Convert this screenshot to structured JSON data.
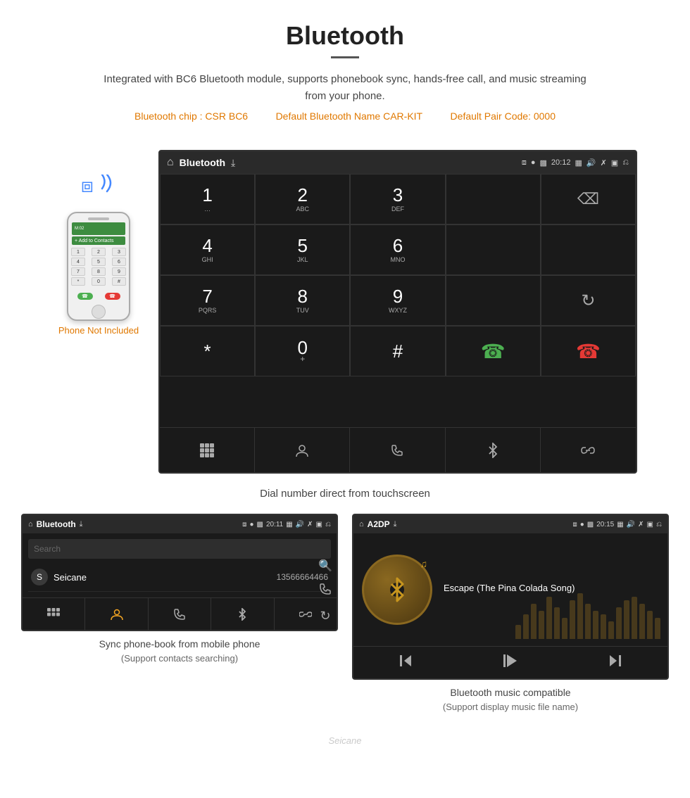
{
  "header": {
    "title": "Bluetooth",
    "description": "Integrated with BC6 Bluetooth module, supports phonebook sync, hands-free call, and music streaming from your phone.",
    "bluetooth_chip": "Bluetooth chip : CSR BC6",
    "default_name": "Default Bluetooth Name CAR-KIT",
    "default_pair": "Default Pair Code: 0000"
  },
  "dial_screen": {
    "title": "Bluetooth",
    "time": "20:12",
    "keys": [
      {
        "num": "1",
        "letters": ""
      },
      {
        "num": "2",
        "letters": "ABC"
      },
      {
        "num": "3",
        "letters": "DEF"
      },
      {
        "num": "4",
        "letters": "GHI"
      },
      {
        "num": "5",
        "letters": "JKL"
      },
      {
        "num": "6",
        "letters": "MNO"
      },
      {
        "num": "7",
        "letters": "PQRS"
      },
      {
        "num": "8",
        "letters": "TUV"
      },
      {
        "num": "9",
        "letters": "WXYZ"
      },
      {
        "num": "*",
        "letters": ""
      },
      {
        "num": "0",
        "letters": "+"
      },
      {
        "num": "#",
        "letters": ""
      }
    ],
    "caption": "Dial number direct from touchscreen"
  },
  "phone": {
    "not_included": "Phone Not Included"
  },
  "phonebook_screen": {
    "title": "Bluetooth",
    "time": "20:11",
    "search_placeholder": "Search",
    "contact_name": "Seicane",
    "contact_number": "13566664466",
    "contact_letter": "S",
    "caption_main": "Sync phone-book from mobile phone",
    "caption_sub": "(Support contacts searching)"
  },
  "music_screen": {
    "title": "A2DP",
    "time": "20:15",
    "song_title": "Escape (The Pina Colada Song)",
    "caption_main": "Bluetooth music compatible",
    "caption_sub": "(Support display music file name)",
    "bars": [
      20,
      35,
      50,
      40,
      60,
      45,
      30,
      55,
      65,
      50,
      40,
      35,
      25,
      45,
      55,
      60,
      50,
      40,
      30,
      50,
      45
    ]
  },
  "watermark": "Seicane"
}
